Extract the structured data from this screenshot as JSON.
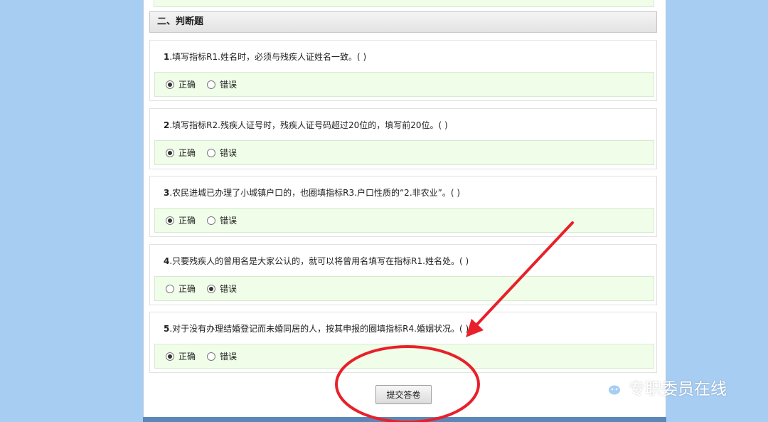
{
  "section": {
    "title": "二、判断题"
  },
  "questions": [
    {
      "num": "1",
      "text": ".填写指标R1.姓名时，必须与残疾人证姓名一致。( )",
      "options": [
        "正确",
        "错误"
      ],
      "selected": 0
    },
    {
      "num": "2",
      "text": ".填写指标R2.残疾人证号时，残疾人证号码超过20位的，填写前20位。( )",
      "options": [
        "正确",
        "错误"
      ],
      "selected": 0
    },
    {
      "num": "3",
      "text": ".农民进城已办理了小城镇户口的，也圈填指标R3.户口性质的“2.非农业”。( )",
      "options": [
        "正确",
        "错误"
      ],
      "selected": 0
    },
    {
      "num": "4",
      "text": ".只要残疾人的曾用名是大家公认的，就可以将曾用名填写在指标R1.姓名处。( )",
      "options": [
        "正确",
        "错误"
      ],
      "selected": 1
    },
    {
      "num": "5",
      "text": ".对于没有办理结婚登记而未婚同居的人，按其申报的圈填指标R4.婚姻状况。( )",
      "options": [
        "正确",
        "错误"
      ],
      "selected": 0
    }
  ],
  "submit": {
    "label": "提交答卷"
  },
  "watermark": {
    "text": "专职委员在线",
    "icon": "wechat-icon"
  },
  "annotation": {
    "color": "#e8202a"
  },
  "colors": {
    "background": "#a7cdf2",
    "option_bg": "#f0fde9",
    "panel_bottom": "#5b87b8"
  }
}
